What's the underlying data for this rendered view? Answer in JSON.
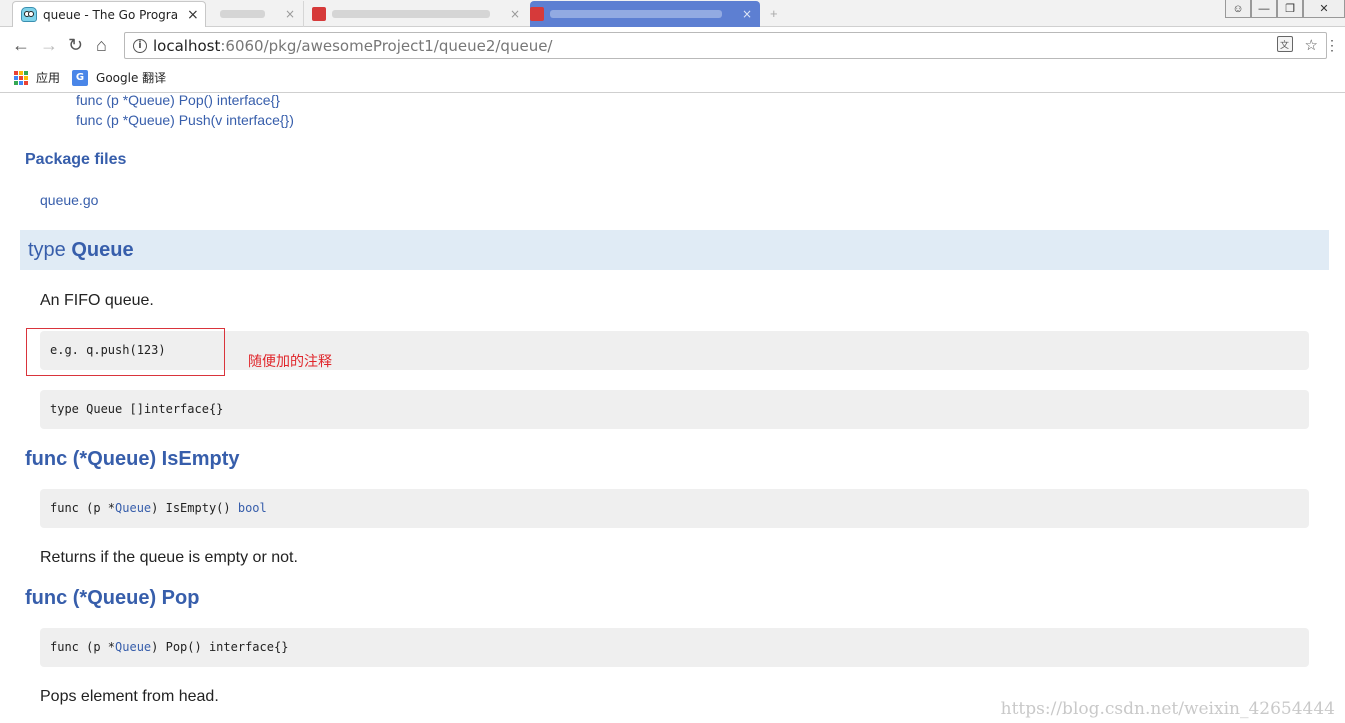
{
  "browser": {
    "tabs": [
      {
        "title": "queue - The Go Progra",
        "active": true
      },
      {
        "title": "",
        "active": false
      },
      {
        "title": "",
        "active": false
      },
      {
        "title": "",
        "active": false
      }
    ],
    "close_glyph": "×",
    "new_tab_glyph": "+",
    "window_controls": {
      "user": "☺",
      "minimize": "—",
      "maximize": "❐",
      "close": "✕"
    },
    "nav": {
      "back": "←",
      "forward": "→",
      "reload": "↻",
      "home": "⌂"
    },
    "url_host": "localhost",
    "url_rest": ":6060/pkg/awesomeProject1/queue2/queue/",
    "info_glyph": "i",
    "translate_glyph": "文",
    "star_glyph": "☆",
    "menu_glyph": "⋮",
    "bookmarks": {
      "apps_label": "应用",
      "google_translate_label": "Google 翻译",
      "g_glyph": "G"
    }
  },
  "index": {
    "items": [
      "func (p *Queue) Pop() interface{}",
      "func (p *Queue) Push(v interface{})"
    ]
  },
  "package_files": {
    "heading": "Package files",
    "file": "queue.go"
  },
  "type_queue": {
    "prefix": "type",
    "name": "Queue",
    "doc": "An FIFO queue.",
    "example_code": "e.g. q.push(123)",
    "annotation": "随便加的注释",
    "decl": "type Queue []interface{}"
  },
  "funcs": [
    {
      "heading": "func (*Queue) IsEmpty",
      "sig_pre": "func (p *",
      "sig_type": "Queue",
      "sig_mid": ") IsEmpty() ",
      "sig_ret": "bool",
      "doc": "Returns if the queue is empty or not."
    },
    {
      "heading": "func (*Queue) Pop",
      "sig_pre": "func (p *",
      "sig_type": "Queue",
      "sig_mid": ") Pop() interface{}",
      "sig_ret": "",
      "doc": "Pops element from head."
    }
  ],
  "watermark": "https://blog.csdn.net/weixin_42654444",
  "colors": {
    "link": "#375eab",
    "type_band": "#e0ebf5",
    "code_bg": "#efefef",
    "annotation_red": "#e0262b"
  }
}
